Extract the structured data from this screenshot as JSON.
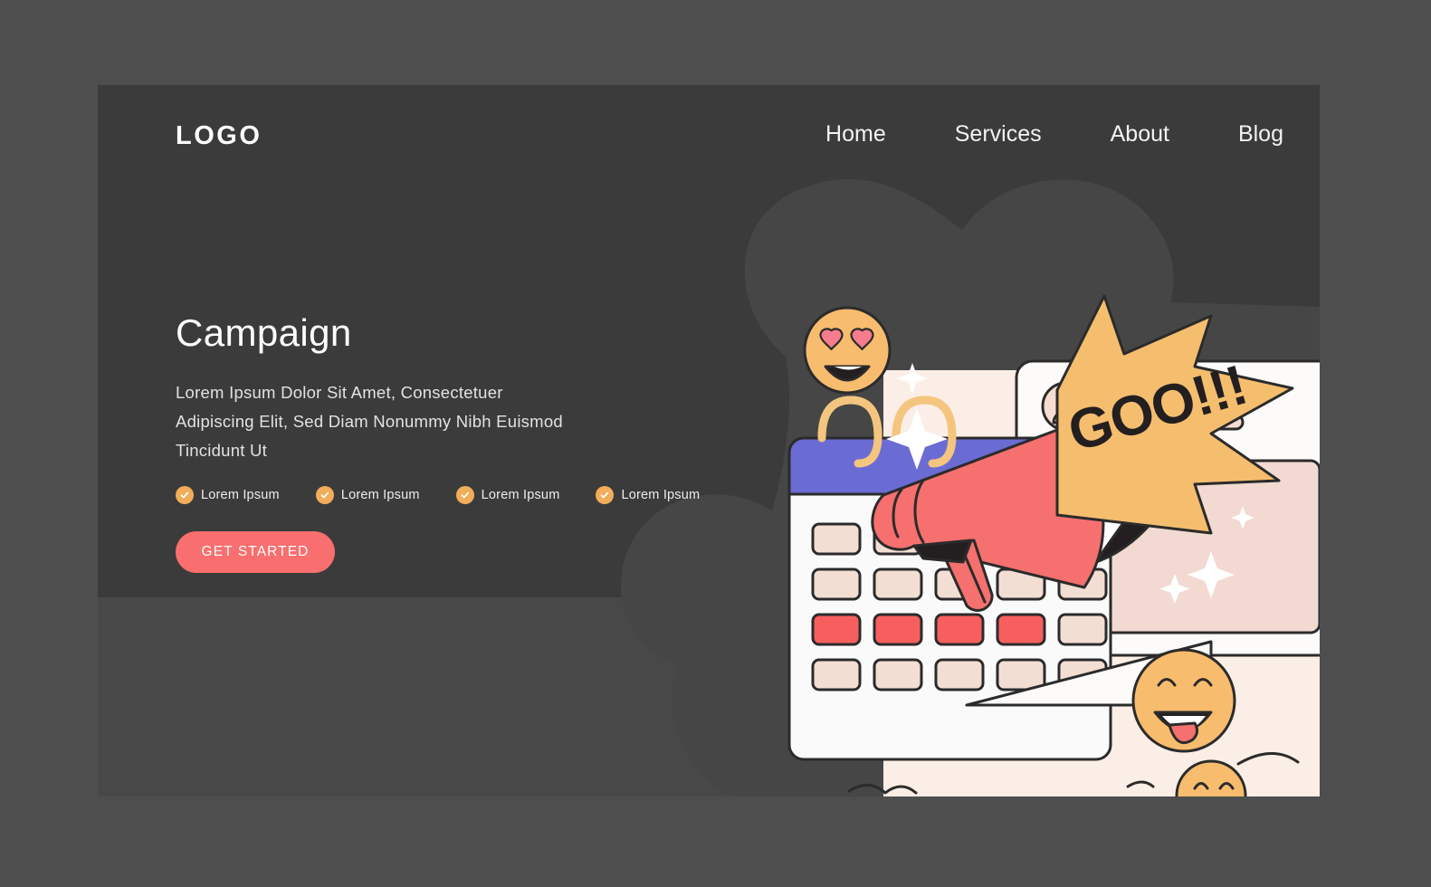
{
  "brand": {
    "logo": "LOGO"
  },
  "nav": {
    "items": [
      {
        "label": "Home"
      },
      {
        "label": "Services"
      },
      {
        "label": "About"
      },
      {
        "label": "Blog"
      }
    ]
  },
  "hero": {
    "title": "Campaign",
    "subtitle": "Lorem Ipsum Dolor Sit Amet, Consectetuer Adipiscing Elit, Sed Diam Nonummy Nibh Euismod Tincidunt Ut",
    "features": [
      {
        "label": "Lorem Ipsum"
      },
      {
        "label": "Lorem Ipsum"
      },
      {
        "label": "Lorem Ipsum"
      },
      {
        "label": "Lorem Ipsum"
      }
    ],
    "cta_label": "GET STARTED"
  },
  "illustration": {
    "speech_bubble_text": "GOO!!!",
    "calendar": {
      "rows": 4,
      "cols": 5,
      "highlighted_row_index": 2,
      "highlighted_cells": 4,
      "header_color": "#6b6bd4",
      "cell_color": "#f3ded4",
      "highlight_color": "#f75f5f",
      "ring_color": "#f3c57f"
    },
    "emojis": [
      {
        "name": "heart-eyes-emoji"
      },
      {
        "name": "tongue-out-emoji"
      },
      {
        "name": "smiling-emoji"
      }
    ],
    "megaphone": {
      "body_color": "#f5706e",
      "inner_color": "#231f20"
    },
    "panel_color": "#fbeee6",
    "card_color": "#fdfbfa"
  },
  "colors": {
    "frame_bg": "#4e4e4e",
    "page_bg": "#484848",
    "hero_bg": "#3b3b3b",
    "blob": "#464646",
    "accent_coral": "#f96e6e",
    "accent_amber": "#f1ad59",
    "bubble_amber": "#f5bd6e",
    "text_light": "#fefefe"
  }
}
